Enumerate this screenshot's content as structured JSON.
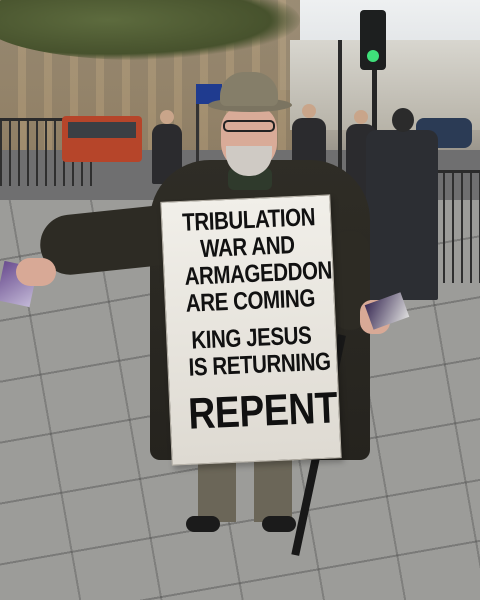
{
  "sign": {
    "lines_top": [
      "TRIBULATION",
      "WAR AND",
      "ARMAGEDDON",
      "ARE COMING"
    ],
    "lines_middle": [
      "KING JESUS",
      "IS RETURNING"
    ],
    "line_bottom": "REPENT"
  },
  "colors": {
    "sign_background": "#ece9e2",
    "sign_text": "#111111",
    "coat": "#2b2923",
    "traffic_light_green": "#3fe07a",
    "eu_flag": "#1f3b8f"
  }
}
